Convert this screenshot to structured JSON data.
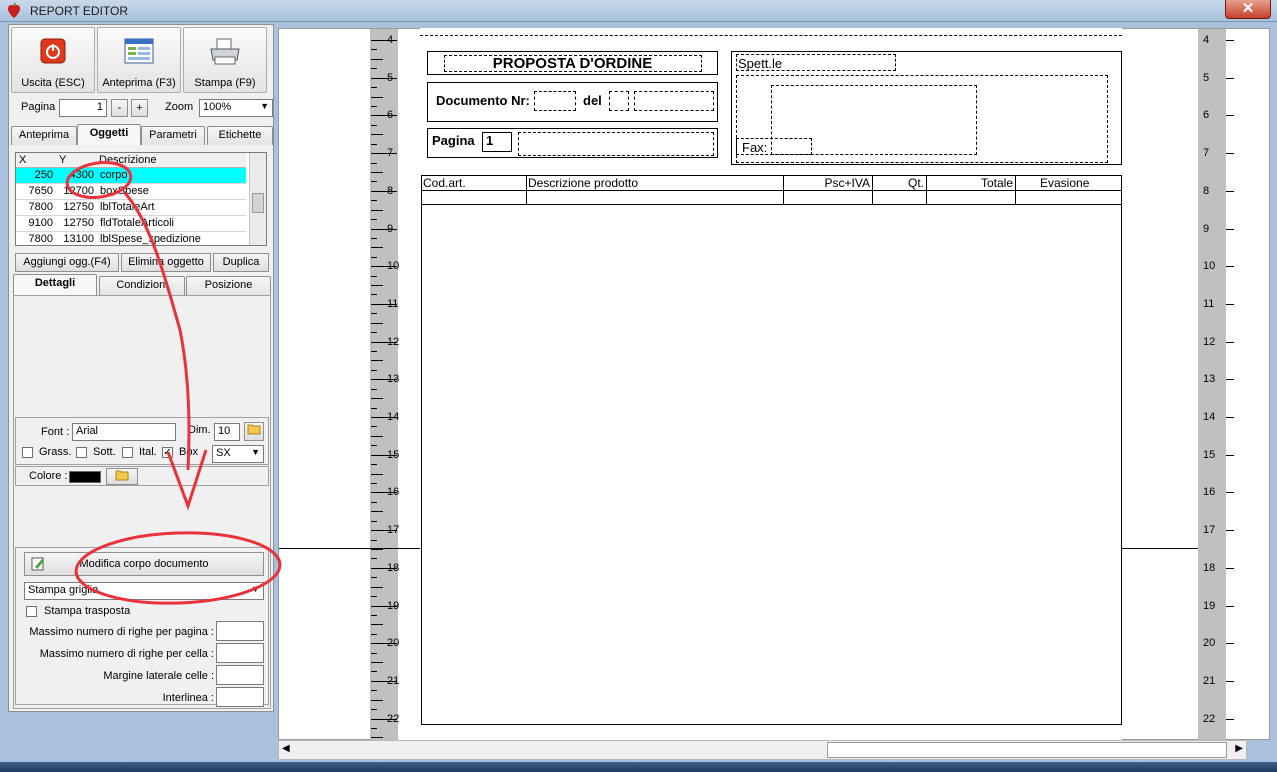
{
  "window": {
    "title": "REPORT EDITOR",
    "close_label": "✕"
  },
  "toolbar": {
    "exit_label": "Uscita (ESC)",
    "preview_label": "Anteprima (F3)",
    "print_label": "Stampa (F9)",
    "page_label": "Pagina",
    "page_value": "1",
    "page_minus": "-",
    "page_plus": "+",
    "zoom_label": "Zoom",
    "zoom_value": "100%"
  },
  "tabs_main": [
    "Anteprima",
    "Oggetti",
    "Parametri",
    "Etichette"
  ],
  "objects_table": {
    "headers": [
      "X",
      "Y",
      "Descrizione"
    ],
    "rows": [
      [
        "250",
        "4300",
        "corpo"
      ],
      [
        "7650",
        "12700",
        "boxSpese"
      ],
      [
        "7800",
        "12750",
        "lblTotaleArt"
      ],
      [
        "9100",
        "12750",
        "fldTotaleArticoli"
      ],
      [
        "7800",
        "13100",
        "lblSpese_spedizione"
      ]
    ]
  },
  "object_buttons": {
    "add": "Aggiungi ogg.(F4)",
    "delete": "Elimina oggetto",
    "duplicate": "Duplica"
  },
  "tabs_details": [
    "Dettagli",
    "Condizioni",
    "Posizione"
  ],
  "font": {
    "font_label": "Font :",
    "font_value": "Arial",
    "dim_label": "Dim.",
    "dim_value": "10",
    "bold_label": "Grass.",
    "underline_label": "Sott.",
    "italic_label": "Ital.",
    "box_label": "Box",
    "align_value": "SX",
    "color_label": "Colore :",
    "color_swatch": "#000000"
  },
  "body_section": {
    "edit_button": "Modifica corpo documento",
    "grid_select": "Stampa griglia",
    "transpose_label": "Stampa trasposta",
    "max_rows_page": "Massimo numero di righe per pagina :",
    "max_rows_cell": "Massimo numero di righe per cella :",
    "cell_margin": "Margine laterale celle :",
    "line_spacing": "Interlinea :"
  },
  "ruler_numbers": [
    "4",
    "5",
    "6",
    "7",
    "8",
    "9",
    "10",
    "11",
    "12",
    "13",
    "14",
    "15",
    "16",
    "17",
    "18",
    "19",
    "20",
    "21",
    "22"
  ],
  "report": {
    "title": "PROPOSTA D'ORDINE",
    "doc_number_label": "Documento Nr:",
    "date_label": "del",
    "page_label": "Pagina",
    "page_value": "1",
    "recipient_label": "Spett.le",
    "fax_label": "Fax:",
    "columns": [
      "Cod.art.",
      "Descrizione prodotto",
      "Psc+IVA",
      "Qt.",
      "Totale",
      "Evasione"
    ]
  },
  "colors": {
    "selection": "#00ffff",
    "annotation": "#e8323c",
    "window_frame": "#a9c1dc"
  }
}
